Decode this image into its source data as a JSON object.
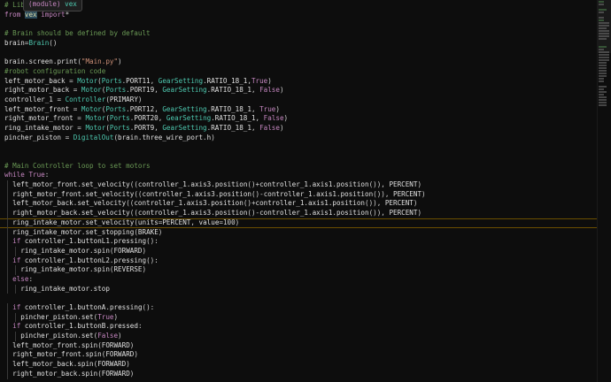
{
  "hover_tooltip": {
    "prefix": "(module)",
    "name": "vex"
  },
  "code_lines": [
    "# Library imports",
    "from vex import*",
    "",
    "# Brain should be defined by default",
    "brain=Brain()",
    "",
    "brain.screen.print(\"Main.py\")",
    "#robot configuration code",
    "left_motor_back = Motor(Ports.PORT11, GearSetting.RATIO_18_1,True)",
    "right_motor_back = Motor(Ports.PORT19, GearSetting.RATIO_18_1, False)",
    "controller_1 = Controller(PRIMARY)",
    "left_motor_front = Motor(Ports.PORT12, GearSetting.RATIO_18_1, True)",
    "right_motor_front = Motor(Ports.PORT20, GearSetting.RATIO_18_1, False)",
    "ring_intake_motor = Motor(Ports.PORT9, GearSetting.RATIO_18_1, False)",
    "pincher_piston = DigitalOut(brain.three_wire_port.h)",
    "",
    "",
    "# Main Controller loop to set motors",
    "while True:",
    "  left_motor_front.set_velocity((controller_1.axis3.position()+controller_1.axis1.position()), PERCENT)",
    "  right_motor_front.set_velocity((controller_1.axis3.position()-controller_1.axis1.position()), PERCENT)",
    "  left_motor_back.set_velocity((controller_1.axis3.position()+controller_1.axis1.position()), PERCENT)",
    "  right_motor_back.set_velocity((controller_1.axis3.position()-controller_1.axis1.position()), PERCENT)",
    "  ring_intake_motor.set_velocity(units=PERCENT, value=100)",
    "  ring_intake_motor.set_stopping(BRAKE)",
    "  if controller_1.buttonL1.pressing():",
    "    ring_intake_motor.spin(FORWARD)",
    "  if controller_1.buttonL2.pressing():",
    "    ring_intake_motor.spin(REVERSE)",
    "  else:",
    "    ring_intake_motor.stop",
    "",
    "  if controller_1.buttonA.pressing():",
    "    pincher_piston.set(True)",
    "  if controller_1.buttonB.pressed:",
    "    pincher_piston.set(False)",
    "  left_motor_front.spin(FORWARD)",
    "  right_motor_front.spin(FORWARD)",
    "  left_motor_back.spin(FORWARD)",
    "  right_motor_back.spin(FORWARD)"
  ],
  "current_line_index": 23,
  "colors": {
    "background": "#0d0d0d",
    "keyword": "#c586c0",
    "comment": "#6a9955",
    "string": "#ce9178",
    "class": "#4ec9b0",
    "current_line_border": "#6b4e00"
  }
}
